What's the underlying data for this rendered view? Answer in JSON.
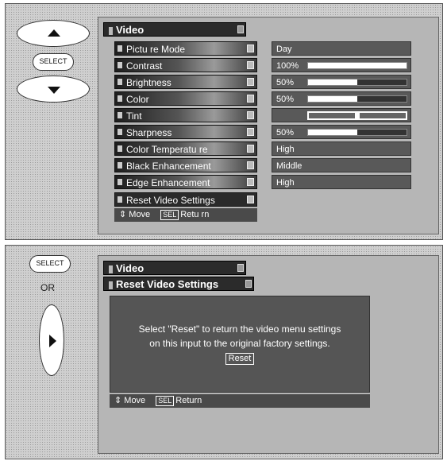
{
  "panel1": {
    "remote": {
      "up_icon": "up-arrow-icon",
      "select_label": "SELECT",
      "down_icon": "down-arrow-icon"
    },
    "title": "Video",
    "items": [
      {
        "label": "Pictu re Mode",
        "value": "Day"
      },
      {
        "label": "Contrast",
        "value": "100%",
        "level": 1.0
      },
      {
        "label": "Brightness",
        "value": "50%",
        "level": 0.5
      },
      {
        "label": "Color",
        "value": "50%",
        "level": 0.5
      },
      {
        "label": "Tint",
        "value": "",
        "level": 0.5
      },
      {
        "label": "Sharpness",
        "value": "50%",
        "level": 0.5
      },
      {
        "label": "Color  Temperatu re",
        "value": "High"
      },
      {
        "label": "Black Enhancement",
        "value": "Middle"
      },
      {
        "label": "Edge Enhancement",
        "value": "High"
      },
      {
        "label": "Reset Video Settings",
        "value": ""
      }
    ],
    "footer": {
      "move": "Move",
      "sel": "SEL",
      "return": "Retu rn"
    }
  },
  "panel2": {
    "remote": {
      "select_label": "SELECT",
      "or_label": "OR",
      "right_icon": "right-arrow-icon"
    },
    "title": "Video",
    "subtitle": "Reset Video Settings",
    "dialog_line1": "Select \"Reset\" to return the video menu settings",
    "dialog_line2": "on this input to the original factory settings.",
    "reset_label": "Reset",
    "footer": {
      "move": "Move",
      "sel": "SEL",
      "return": "Return"
    }
  }
}
